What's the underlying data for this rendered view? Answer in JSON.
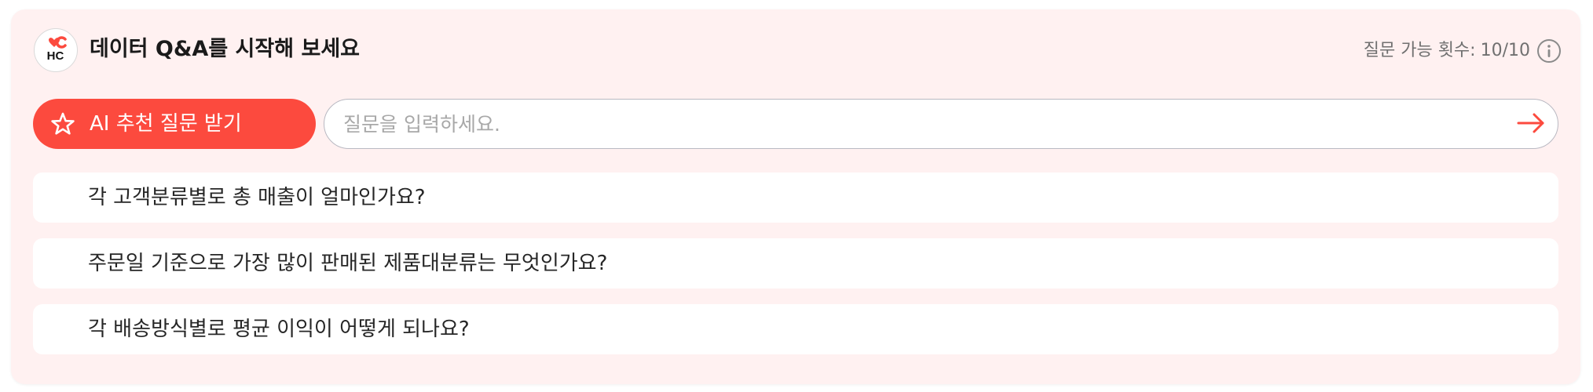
{
  "header": {
    "logo_text": "HC",
    "title": "데이터 Q&A를 시작해 보세요",
    "counter_label": "질문 가능 횟수:",
    "counter_value": "10/10",
    "info_icon": "info-circle-icon"
  },
  "ai_button": {
    "icon": "star-icon",
    "label": "AI 추천 질문 받기"
  },
  "question_input": {
    "placeholder": "질문을 입력하세요.",
    "value": "",
    "send_icon": "arrow-right-icon"
  },
  "suggestions": [
    {
      "text": "각 고객분류별로 총 매출이 얼마인가요?"
    },
    {
      "text": "주문일 기준으로 가장 많이 판매된 제품대분류는 무엇인가요?"
    },
    {
      "text": "각 배송방식별로 평균 이익이 어떻게 되나요?"
    }
  ],
  "colors": {
    "accent": "#fc4a3e",
    "panel_background": "#fff1f1",
    "card_background": "#ffffff",
    "muted_text": "#707070"
  }
}
